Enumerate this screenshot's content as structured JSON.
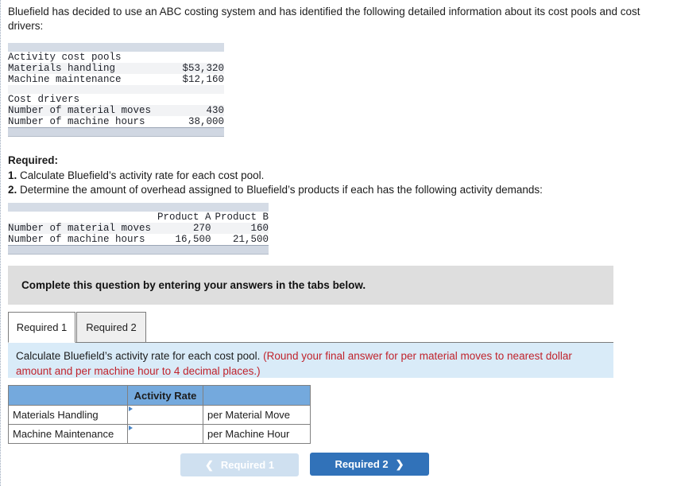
{
  "intro": "Bluefield has decided to use an ABC costing system and has identified the following detailed information about its cost pools and cost drivers:",
  "cost_pool_table": {
    "rows": [
      {
        "label": "Activity cost pools",
        "value": "",
        "indent": 1
      },
      {
        "label": "Materials handling",
        "value": "$53,320",
        "indent": 2
      },
      {
        "label": "Machine maintenance",
        "value": "$12,160",
        "indent": 2
      },
      {
        "label": "Cost drivers",
        "value": "",
        "indent": 1
      },
      {
        "label": "Number of material moves",
        "value": "430",
        "indent": 2
      },
      {
        "label": "Number of machine hours",
        "value": "38,000",
        "indent": 2
      }
    ]
  },
  "required": {
    "heading": "Required:",
    "item1_num": "1.",
    "item1_text": " Calculate Bluefield’s activity rate for each cost pool.",
    "item2_num": "2.",
    "item2_text": " Determine the amount of overhead assigned to Bluefield’s products if each has the following activity demands:"
  },
  "demand_table": {
    "columns": [
      "",
      "Product A",
      "Product B"
    ],
    "rows": [
      {
        "label": "Number of material moves",
        "a": "270",
        "b": "160"
      },
      {
        "label": "Number of machine hours",
        "a": "16,500",
        "b": "21,500"
      }
    ]
  },
  "banner": {
    "text": "Complete this question by entering your answers in the tabs below."
  },
  "tabs": [
    {
      "label": "Required 1",
      "active": true
    },
    {
      "label": "Required 2",
      "active": false
    }
  ],
  "infobox": {
    "prompt": "Calculate Bluefield’s activity rate for each cost pool. ",
    "note": "(Round your final answer for per material moves to nearest dollar amount and per machine hour to 4 decimal places.)"
  },
  "answer_grid": {
    "headers": [
      "",
      "Activity Rate",
      ""
    ],
    "rows": [
      {
        "label": "Materials Handling",
        "rate": "",
        "unit": "per Material Move"
      },
      {
        "label": "Machine Maintenance",
        "rate": "",
        "unit": "per Machine Hour"
      }
    ]
  },
  "nav": {
    "prev_label": "Required 1",
    "prev_icon": "chevron-left",
    "next_label": "Required 2",
    "next_icon": "chevron-right"
  },
  "colors": {
    "accent_blue": "#3172b9",
    "grid_header_blue": "#74a9dd",
    "info_box_blue": "#d9ebf8",
    "note_red": "#c0232c",
    "banner_gray": "#dedede",
    "table_bar": "#d5dce6"
  }
}
